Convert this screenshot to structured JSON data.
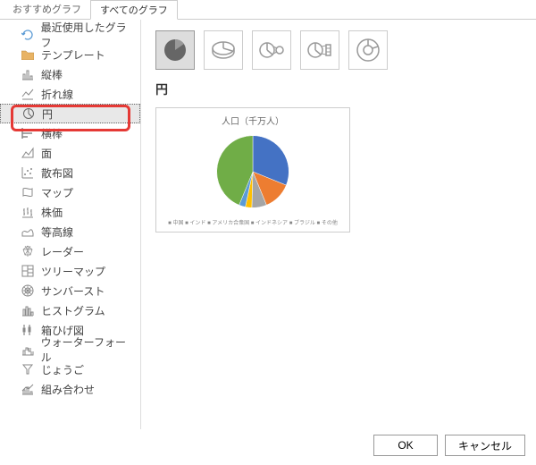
{
  "tabs": {
    "recommended": "おすすめグラフ",
    "all": "すべてのグラフ"
  },
  "sidebar": {
    "items": [
      {
        "label": "最近使用したグラフ"
      },
      {
        "label": "テンプレート"
      },
      {
        "label": "縦棒"
      },
      {
        "label": "折れ線"
      },
      {
        "label": "円"
      },
      {
        "label": "横棒"
      },
      {
        "label": "面"
      },
      {
        "label": "散布図"
      },
      {
        "label": "マップ"
      },
      {
        "label": "株価"
      },
      {
        "label": "等高線"
      },
      {
        "label": "レーダー"
      },
      {
        "label": "ツリーマップ"
      },
      {
        "label": "サンバースト"
      },
      {
        "label": "ヒストグラム"
      },
      {
        "label": "箱ひげ図"
      },
      {
        "label": "ウォーターフォール"
      },
      {
        "label": "じょうご"
      },
      {
        "label": "組み合わせ"
      }
    ]
  },
  "content": {
    "section_title": "円",
    "preview_title": "人口（千万人）"
  },
  "chart_data": {
    "type": "pie",
    "title": "人口（千万人）",
    "series": [
      {
        "name": "中国",
        "value": 140,
        "color": "#4472C4"
      },
      {
        "name": "インド",
        "value": 57,
        "color": "#ED7D31"
      },
      {
        "name": "アメリカ合衆国",
        "value": 30,
        "color": "#A5A5A5"
      },
      {
        "name": "インドネシア",
        "value": 13,
        "color": "#FFC000"
      },
      {
        "name": "ブラジル",
        "value": 13,
        "color": "#5B9BD5"
      },
      {
        "name": "その他",
        "value": 197,
        "color": "#70AD47"
      }
    ],
    "legend_position": "bottom"
  },
  "buttons": {
    "ok": "OK",
    "cancel": "キャンセル"
  }
}
